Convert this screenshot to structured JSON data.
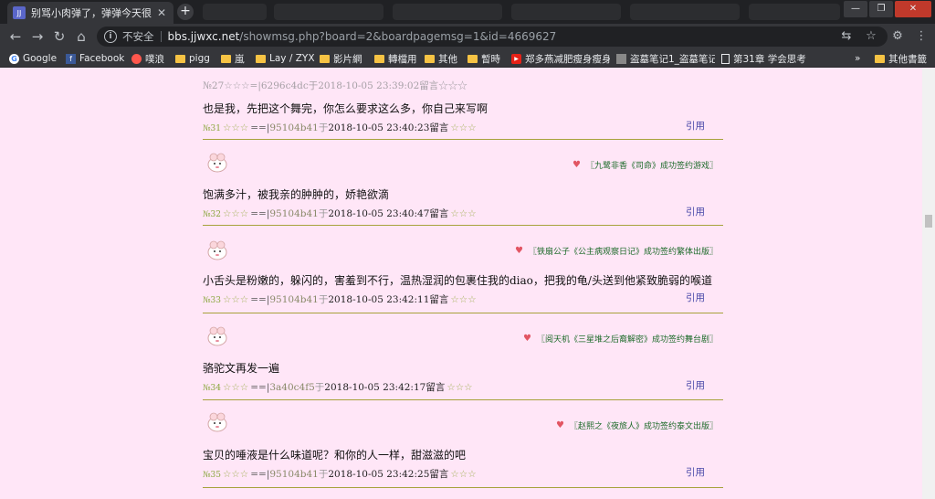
{
  "browser": {
    "tab_title": "别骂小肉弹了，弹弹今天很美很",
    "tab_favicon": "JJ",
    "new_tab": "+",
    "window_buttons": [
      "—",
      "❐",
      "✕"
    ],
    "url_insecure_label": "不安全",
    "url_host": "bbs.jjwxc.net",
    "url_path": "/showmsg.php?board=2&boardpagemsg=1&id=4669627",
    "bookmarks": [
      {
        "label": "Google",
        "kind": "google"
      },
      {
        "label": "Facebook",
        "kind": "facebook"
      },
      {
        "label": "噗浪",
        "kind": "plurk"
      },
      {
        "label": "pigg",
        "kind": "folder"
      },
      {
        "label": "嵐",
        "kind": "folder"
      },
      {
        "label": "Lay / ZYX",
        "kind": "folder"
      },
      {
        "label": "影片網",
        "kind": "folder"
      },
      {
        "label": "轉檔用",
        "kind": "folder"
      },
      {
        "label": "其他",
        "kind": "folder"
      },
      {
        "label": "暫時",
        "kind": "folder"
      },
      {
        "label": "郑多燕减肥瘦身瘦身",
        "kind": "youtube"
      },
      {
        "label": "盗墓笔记1_盗墓笔记",
        "kind": "image"
      },
      {
        "label": "第31章 学会思考",
        "kind": "page"
      }
    ],
    "bookmarks_more": "»",
    "other_bookmarks": "其他書籤",
    "colors": {
      "chrome": "#35363a",
      "titlebar": "#202124",
      "page_bg": "#ffe6f7"
    }
  },
  "page": {
    "prev_meta": "№27☆☆☆=|6296c4dc于2018-10-05 23:39:02留言☆☆☆",
    "posts": [
      {
        "body": "也是我，先把这个舞完，你怎么要求这么多，你自己来写啊",
        "num": "№31",
        "stars": "☆☆☆",
        "eq": "==|",
        "uid": "95104b41",
        "yu": "于",
        "date": "2018-10-05 23:40:23",
        "liu": "留言",
        "stars_after": "☆☆☆",
        "quote": "引用",
        "sig": ""
      },
      {
        "sig": "〖九鹭非香《司命》成功签约游戏〗",
        "body": "饱满多汁，被我亲的肿肿的，娇艳欲滴",
        "num": "№32",
        "stars": "☆☆☆",
        "eq": "==|",
        "uid": "95104b41",
        "yu": "于",
        "date": "2018-10-05 23:40:47",
        "liu": "留言",
        "stars_after": "☆☆☆",
        "quote": "引用"
      },
      {
        "sig": "〖铁扇公子《公主病观察日记》成功签约繁体出版〗",
        "body": "小舌头是粉嫩的，躲闪的，害羞到不行，温热湿润的包裹住我的diao，把我的龟/头送到他紧致脆弱的喉道",
        "num": "№33",
        "stars": "☆☆☆",
        "eq": "==|",
        "uid": "95104b41",
        "yu": "于",
        "date": "2018-10-05 23:42:11",
        "liu": "留言",
        "stars_after": "☆☆☆",
        "quote": "引用"
      },
      {
        "sig": "〖阅天机《三星堆之后裔解密》成功签约舞台剧〗",
        "body": "骆驼文再发一遍",
        "num": "№34",
        "stars": "☆☆☆",
        "eq": "==|",
        "uid": "3a40c4f5",
        "yu": "于",
        "date": "2018-10-05 23:42:17",
        "liu": "留言",
        "stars_after": "☆☆☆",
        "quote": "引用"
      },
      {
        "sig": "〖赵熙之《夜旅人》成功签约泰文出版〗",
        "body": "宝贝的唾液是什么味道呢？和你的人一样，甜滋滋的吧",
        "num": "№35",
        "stars": "☆☆☆",
        "eq": "==|",
        "uid": "95104b41",
        "yu": "于",
        "date": "2018-10-05 23:42:25",
        "liu": "留言",
        "stars_after": "☆☆☆",
        "quote": "引用"
      }
    ]
  }
}
